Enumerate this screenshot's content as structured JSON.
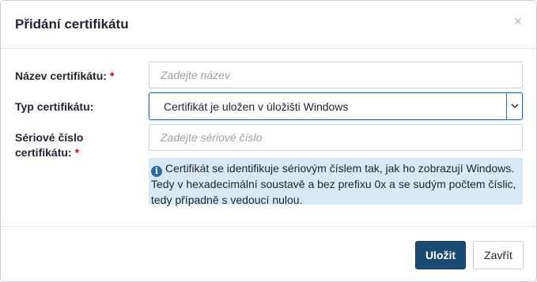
{
  "dialog": {
    "title": "Přidání certifikátu",
    "close_glyph": "×"
  },
  "form": {
    "name": {
      "label": "Název certifikátu:",
      "required_mark": "*",
      "placeholder": "Zadejte název",
      "value": ""
    },
    "type": {
      "label": "Typ certifikátu:",
      "selected": "Certifikát je uložen v úložišti Windows"
    },
    "serial": {
      "label_line1": "Sériové číslo",
      "label_line2": "certifikátu:",
      "required_mark": "*",
      "placeholder": "Zadejte sériové číslo",
      "value": ""
    },
    "info": {
      "icon": "info-icon",
      "icon_glyph": "i",
      "text": "Certifikát se identifikuje sériovým číslem tak, jak ho zobrazují Windows. Tedy v hexadecimální soustavě a bez prefixu 0x a se sudým počtem číslic, tedy případně s vedoucí nulou."
    }
  },
  "buttons": {
    "save": "Uložit",
    "close": "Zavřít"
  },
  "colors": {
    "primary": "#1b4b73",
    "info_bg": "#d6e9f5",
    "required": "#d0021b",
    "focus_border": "#2d6ea8"
  }
}
